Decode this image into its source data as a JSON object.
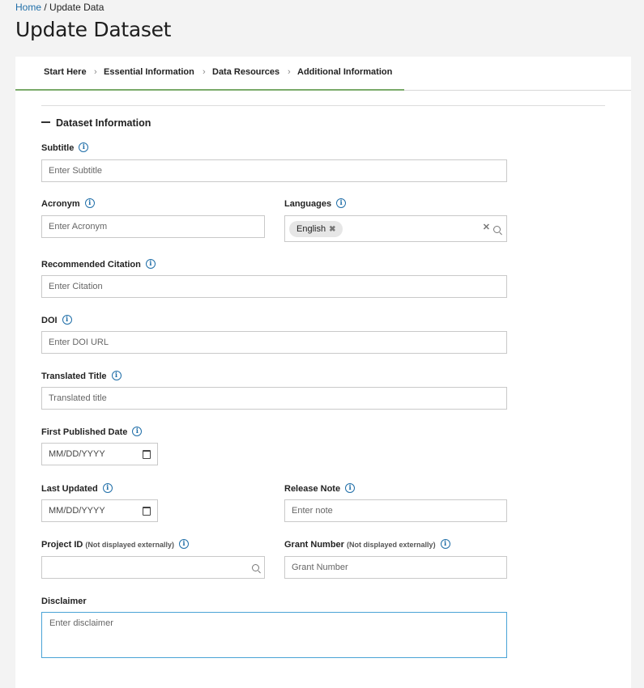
{
  "breadcrumb": {
    "home": "Home",
    "separator": "/",
    "current": "Update Data"
  },
  "page_title": "Update Dataset",
  "tabs": [
    {
      "label": "Start Here"
    },
    {
      "label": "Essential Information"
    },
    {
      "label": "Data Resources"
    },
    {
      "label": "Additional Information"
    }
  ],
  "tab_separator": "›",
  "section": {
    "title": "Dataset Information"
  },
  "fields": {
    "subtitle": {
      "label": "Subtitle",
      "placeholder": "Enter Subtitle"
    },
    "acronym": {
      "label": "Acronym",
      "placeholder": "Enter Acronym"
    },
    "languages": {
      "label": "Languages",
      "tags": [
        "English"
      ]
    },
    "citation": {
      "label": "Recommended Citation",
      "placeholder": "Enter Citation"
    },
    "doi": {
      "label": "DOI",
      "placeholder": "Enter DOI URL"
    },
    "translated_title": {
      "label": "Translated Title",
      "placeholder": "Translated title"
    },
    "first_published": {
      "label": "First Published Date",
      "placeholder": "MM/DD/YYYY"
    },
    "last_updated": {
      "label": "Last Updated",
      "placeholder": "MM/DD/YYYY"
    },
    "release_note": {
      "label": "Release Note",
      "placeholder": "Enter note"
    },
    "project_id": {
      "label": "Project ID",
      "note": "(Not displayed externally)",
      "value": ""
    },
    "grant_number": {
      "label": "Grant Number",
      "note": "(Not displayed externally)",
      "placeholder": "Grant Number"
    },
    "disclaimer": {
      "label": "Disclaimer",
      "placeholder": "Enter disclaimer"
    }
  },
  "info_glyph": "i",
  "tag_remove_glyph": "✖",
  "clear_glyph": "✕",
  "colors": {
    "link": "#1f6ea8",
    "tab_underline": "#7aab6a",
    "focus_border": "#4aa3d6",
    "info_icon": "#1f6ea8"
  },
  "icons": {
    "info": "info-circle-icon",
    "calendar": "calendar-icon",
    "search": "search-icon",
    "remove": "remove-tag-icon",
    "clear": "clear-icon"
  }
}
